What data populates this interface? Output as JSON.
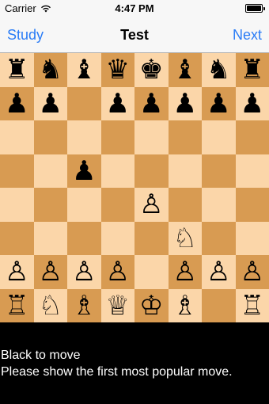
{
  "status_bar": {
    "carrier": "Carrier",
    "time": "4:47 PM",
    "wifi_icon": "wifi-icon",
    "battery_icon": "battery-icon"
  },
  "nav": {
    "left_label": "Study",
    "title": "Test",
    "right_label": "Next",
    "accent_color": "#2a7cf6"
  },
  "board": {
    "light_color": "#fbd6a9",
    "dark_color": "#d89b52",
    "ranks": [
      [
        "bR",
        "bN",
        "bB",
        "bQ",
        "bK",
        "bB",
        "bN",
        "bR"
      ],
      [
        "bP",
        "bP",
        "",
        "bP",
        "bP",
        "bP",
        "bP",
        "bP"
      ],
      [
        "",
        "",
        "",
        "",
        "",
        "",
        "",
        ""
      ],
      [
        "",
        "",
        "bP",
        "",
        "",
        "",
        "",
        ""
      ],
      [
        "",
        "",
        "",
        "",
        "wP",
        "",
        "",
        ""
      ],
      [
        "",
        "",
        "",
        "",
        "",
        "wN",
        "",
        ""
      ],
      [
        "wP",
        "wP",
        "wP",
        "wP",
        "",
        "wP",
        "wP",
        "wP"
      ],
      [
        "wR",
        "wN",
        "wB",
        "wQ",
        "wK",
        "wB",
        "",
        "wR"
      ]
    ]
  },
  "prompt": {
    "line1": "Black to move",
    "line2": "Please show the first most popular move."
  }
}
